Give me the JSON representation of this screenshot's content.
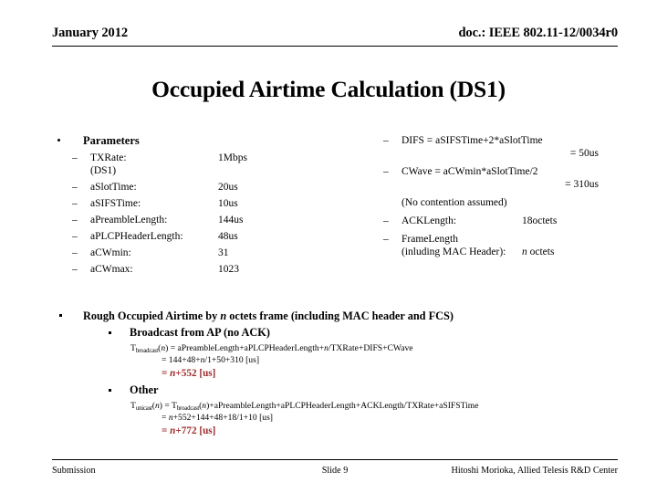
{
  "header": {
    "date": "January 2012",
    "doc": "doc.: IEEE 802.11-12/0034r0"
  },
  "title": "Occupied Airtime Calculation (DS1)",
  "left_column": {
    "heading": "Parameters",
    "rows": [
      {
        "label": "TXRate:",
        "value": "1Mbps"
      },
      {
        "label": "(DS1)",
        "value": ""
      },
      {
        "label": "aSlotTime:",
        "value": "20us"
      },
      {
        "label": "aSIFSTime:",
        "value": "10us"
      },
      {
        "label": "aPreambleLength:",
        "value": "144us"
      },
      {
        "label": "aPLCPHeaderLength:",
        "value": "48us"
      },
      {
        "label": "aCWmin:",
        "value": "31"
      },
      {
        "label": "aCWmax:",
        "value": "1023"
      }
    ]
  },
  "right_column": {
    "difs_expr": "DIFS = aSIFSTime+2*aSlotTime",
    "difs_result": "= 50us",
    "cwave_expr": "CWave = aCWmin*aSlotTime/2",
    "cwave_result": "= 310us",
    "note": "(No contention assumed)",
    "acklength_label": "ACKLength:",
    "acklength_value": "18octets",
    "framelength_label": "FrameLength",
    "framelength_cont": "(inluding MAC Header):",
    "framelength_value_italic": "n",
    "framelength_value_rest": " octets"
  },
  "lower": {
    "heading_pre": "Rough Occupied Airtime by ",
    "heading_italic": "n",
    "heading_post": " octets frame (including MAC header and FCS)",
    "case1": {
      "label": "Broadcast from AP (no ACK)",
      "fn_base": "T",
      "fn_sub": "broadcast",
      "fn_arg_open": "(",
      "fn_arg_italic": "n",
      "fn_arg_close": ")",
      "line1_rest": " = aPreambleLength+aPLCPHeaderLength+",
      "line1_italic": "n",
      "line1_tail": "/TXRate+DIFS+CWave",
      "line2_pre": "= 144+48+",
      "line2_italic": "n",
      "line2_post": "/1+50+310 [us]",
      "result_pre": "= ",
      "result_italic": "n",
      "result_post": "+552 [us]"
    },
    "case2": {
      "label": "Other",
      "fn_base": "T",
      "fn_sub": "unicast",
      "fn_arg_open": "(",
      "fn_arg_italic": "n",
      "fn_arg_close": ")",
      "line1_eq": " = T",
      "line1_sub": "broadcast",
      "line1_arg_open": "(",
      "line1_arg_italic": "n",
      "line1_arg_close": ")",
      "line1_tail": "+aPreambleLength+aPLCPHeaderLength+ACKLength/TXRate+aSIFSTime",
      "line2_pre": "= ",
      "line2_italic": "n",
      "line2_post": "+552+144+48+18/1+10 [us]",
      "result_pre": "= ",
      "result_italic": "n",
      "result_post": "+772 [us]"
    }
  },
  "footer": {
    "left": "Submission",
    "center": "Slide 9",
    "right": "Hitoshi Morioka, Allied Telesis R&D Center"
  },
  "colors": {
    "result_red": "#9e2a2b",
    "text": "#000000",
    "background": "#ffffff"
  },
  "glyphs": {
    "dash": "–",
    "bullet_round": "•",
    "bullet_square": "▪"
  }
}
